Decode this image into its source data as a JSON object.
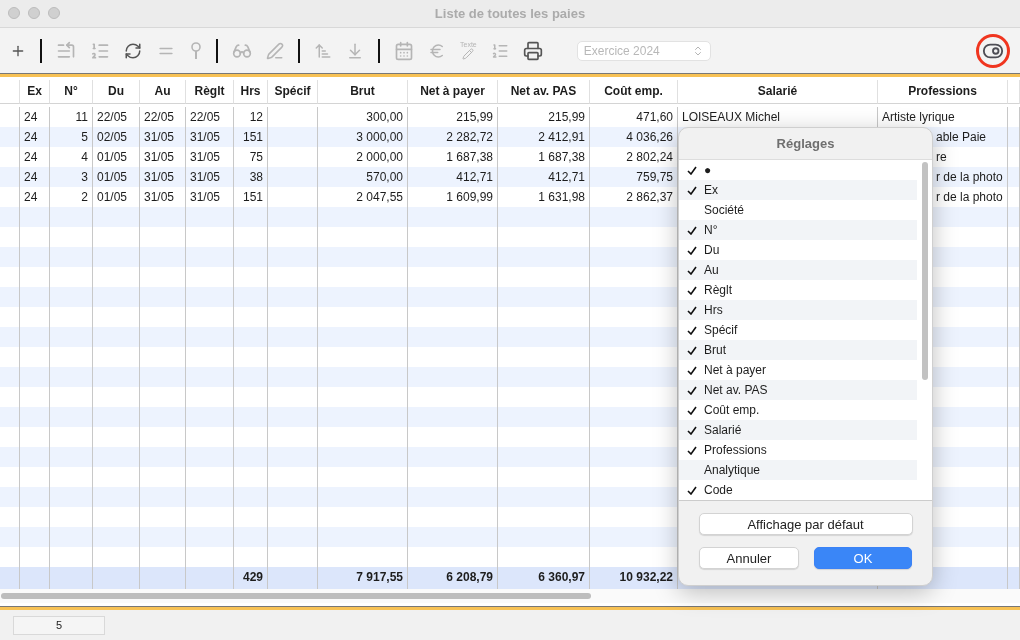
{
  "window": {
    "title": "Liste de toutes les paies",
    "active": false
  },
  "toolbar": {
    "text_tool_label": "Texte",
    "year_select": {
      "value": "Exercice 2024",
      "disabled": true
    },
    "display_toggle": {
      "on": true,
      "highlighted": true
    }
  },
  "table": {
    "columns": [
      "Ex",
      "N°",
      "Du",
      "Au",
      "Règlt",
      "Hrs",
      "Spécif",
      "Brut",
      "Net à payer",
      "Net av. PAS",
      "Coût emp.",
      "Salarié",
      "Professions"
    ],
    "rows": [
      {
        "ex": "24",
        "no": "11",
        "du": "22/05",
        "au": "22/05",
        "reglt": "22/05",
        "hrs": "12",
        "brut": "300,00",
        "net": "215,99",
        "net_pas": "215,99",
        "cout": "471,60",
        "salarie": "LOISEAUX Michel",
        "profession": "Artiste lyrique",
        "profession_covered": false
      },
      {
        "ex": "24",
        "no": "5",
        "du": "02/05",
        "au": "31/05",
        "reglt": "31/05",
        "hrs": "151",
        "brut": "3 000,00",
        "net": "2 282,72",
        "net_pas": "2 412,91",
        "cout": "4 036,26",
        "profession": "able Paie",
        "profession_covered": true
      },
      {
        "ex": "24",
        "no": "4",
        "du": "01/05",
        "au": "31/05",
        "reglt": "31/05",
        "hrs": "75",
        "brut": "2 000,00",
        "net": "1 687,38",
        "net_pas": "1 687,38",
        "cout": "2 802,24",
        "profession": "re",
        "profession_covered": true
      },
      {
        "ex": "24",
        "no": "3",
        "du": "01/05",
        "au": "31/05",
        "reglt": "31/05",
        "hrs": "38",
        "brut": "570,00",
        "net": "412,71",
        "net_pas": "412,71",
        "cout": "759,75",
        "profession": "r de la photo",
        "profession_covered": true
      },
      {
        "ex": "24",
        "no": "2",
        "du": "01/05",
        "au": "31/05",
        "reglt": "31/05",
        "hrs": "151",
        "brut": "2 047,55",
        "net": "1 609,99",
        "net_pas": "1 631,98",
        "cout": "2 862,37",
        "profession": "r de la photo",
        "profession_covered": true
      }
    ],
    "totals": {
      "hrs": "429",
      "brut": "7 917,55",
      "net": "6 208,79",
      "net_pas": "6 360,97",
      "cout": "10 932,22"
    }
  },
  "settings_popover": {
    "title": "Réglages",
    "items": [
      {
        "label": "●",
        "checked": true
      },
      {
        "label": "Ex",
        "checked": true
      },
      {
        "label": "Société",
        "checked": false
      },
      {
        "label": "N°",
        "checked": true
      },
      {
        "label": "Du",
        "checked": true
      },
      {
        "label": "Au",
        "checked": true
      },
      {
        "label": "Règlt",
        "checked": true
      },
      {
        "label": "Hrs",
        "checked": true
      },
      {
        "label": "Spécif",
        "checked": true
      },
      {
        "label": "Brut",
        "checked": true
      },
      {
        "label": "Net à payer",
        "checked": true
      },
      {
        "label": "Net av. PAS",
        "checked": true
      },
      {
        "label": "Coût emp.",
        "checked": true
      },
      {
        "label": "Salarié",
        "checked": true
      },
      {
        "label": "Professions",
        "checked": true
      },
      {
        "label": "Analytique",
        "checked": false
      },
      {
        "label": "Code",
        "checked": true
      }
    ],
    "default_button": "Affichage par défaut",
    "cancel_button": "Annuler",
    "ok_button": "OK"
  },
  "status_bar": {
    "count": "5"
  }
}
